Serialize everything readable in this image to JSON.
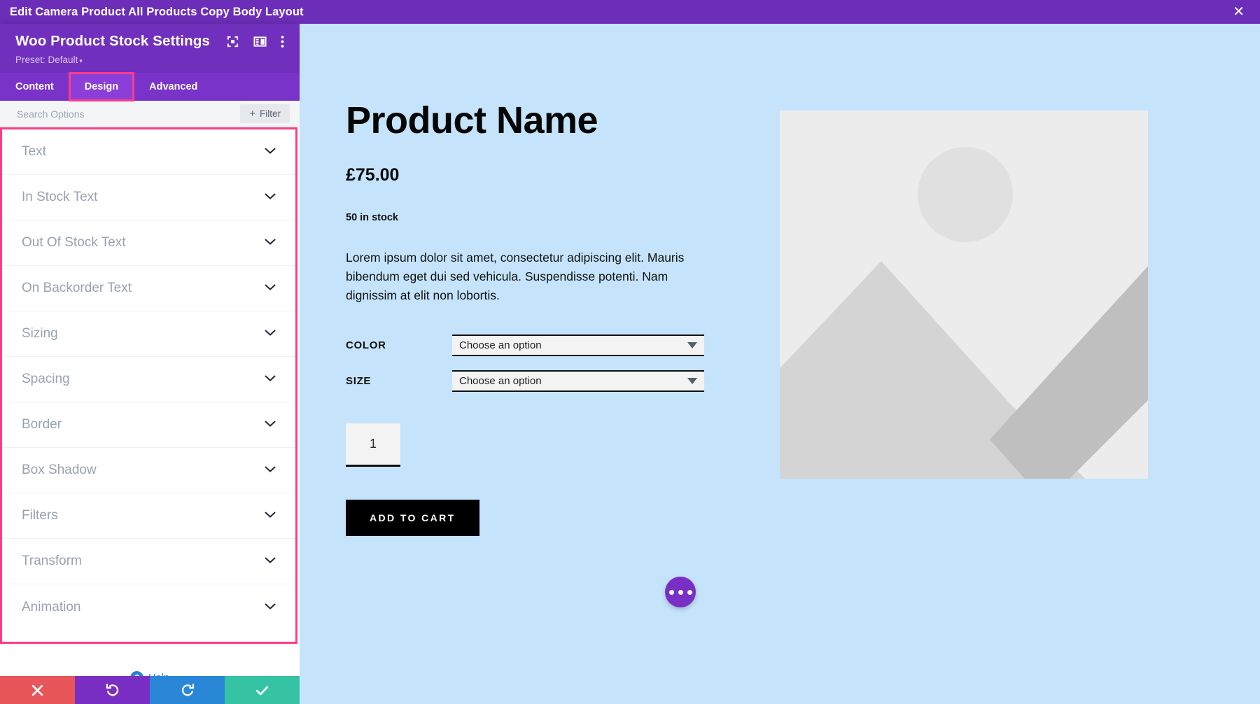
{
  "titlebar": {
    "title": "Edit Camera Product All Products Copy Body Layout",
    "close_label": "✕"
  },
  "panel": {
    "title": "Woo Product Stock Settings",
    "preset_label": "Preset: Default",
    "preset_caret": "▾",
    "head_icons": [
      "responsive-view-icon",
      "layout-columns-icon",
      "kebab-menu-icon"
    ],
    "tabs": [
      {
        "label": "Content",
        "active": false,
        "highlight": false
      },
      {
        "label": "Design",
        "active": true,
        "highlight": true
      },
      {
        "label": "Advanced",
        "active": false,
        "highlight": false
      }
    ],
    "search": {
      "placeholder": "Search Options",
      "value": ""
    },
    "filter_button": {
      "plus": "+",
      "label": "Filter"
    },
    "sections": [
      {
        "label": "Text"
      },
      {
        "label": "In Stock Text"
      },
      {
        "label": "Out Of Stock Text"
      },
      {
        "label": "On Backorder Text"
      },
      {
        "label": "Sizing"
      },
      {
        "label": "Spacing"
      },
      {
        "label": "Border"
      },
      {
        "label": "Box Shadow"
      },
      {
        "label": "Filters"
      },
      {
        "label": "Transform"
      },
      {
        "label": "Animation"
      }
    ],
    "help": {
      "badge": "?",
      "label": "Help"
    },
    "footer_buttons": [
      {
        "name": "cancel-button",
        "icon": "close-icon",
        "color": "#e8565a"
      },
      {
        "name": "undo-button",
        "icon": "undo-icon",
        "color": "#7a2fc4"
      },
      {
        "name": "redo-button",
        "icon": "redo-icon",
        "color": "#2a87d8"
      },
      {
        "name": "save-button",
        "icon": "check-icon",
        "color": "#35c3a3"
      }
    ]
  },
  "preview": {
    "product": {
      "name": "Product Name",
      "price": "£75.00",
      "stock": "50 in stock",
      "description": "Lorem ipsum dolor sit amet, consectetur adipiscing elit. Mauris bibendum eget dui sed vehicula. Suspendisse potenti. Nam dignissim at elit non lobortis.",
      "attributes": [
        {
          "label": "COLOR",
          "value": "Choose an option"
        },
        {
          "label": "SIZE",
          "value": "Choose an option"
        }
      ],
      "quantity": "1",
      "add_to_cart_label": "ADD TO CART"
    },
    "fab": {
      "name": "more-options-fab"
    }
  },
  "colors": {
    "titlebar_purple": "#6c2eb9",
    "panel_purple": "#7030bd",
    "tabs_purple": "#7a33c9",
    "tab_active_purple": "#8b3fd8",
    "highlight_pink": "#ff3c8a",
    "preview_blue": "#c5e4fb",
    "accent_black": "#000000"
  }
}
